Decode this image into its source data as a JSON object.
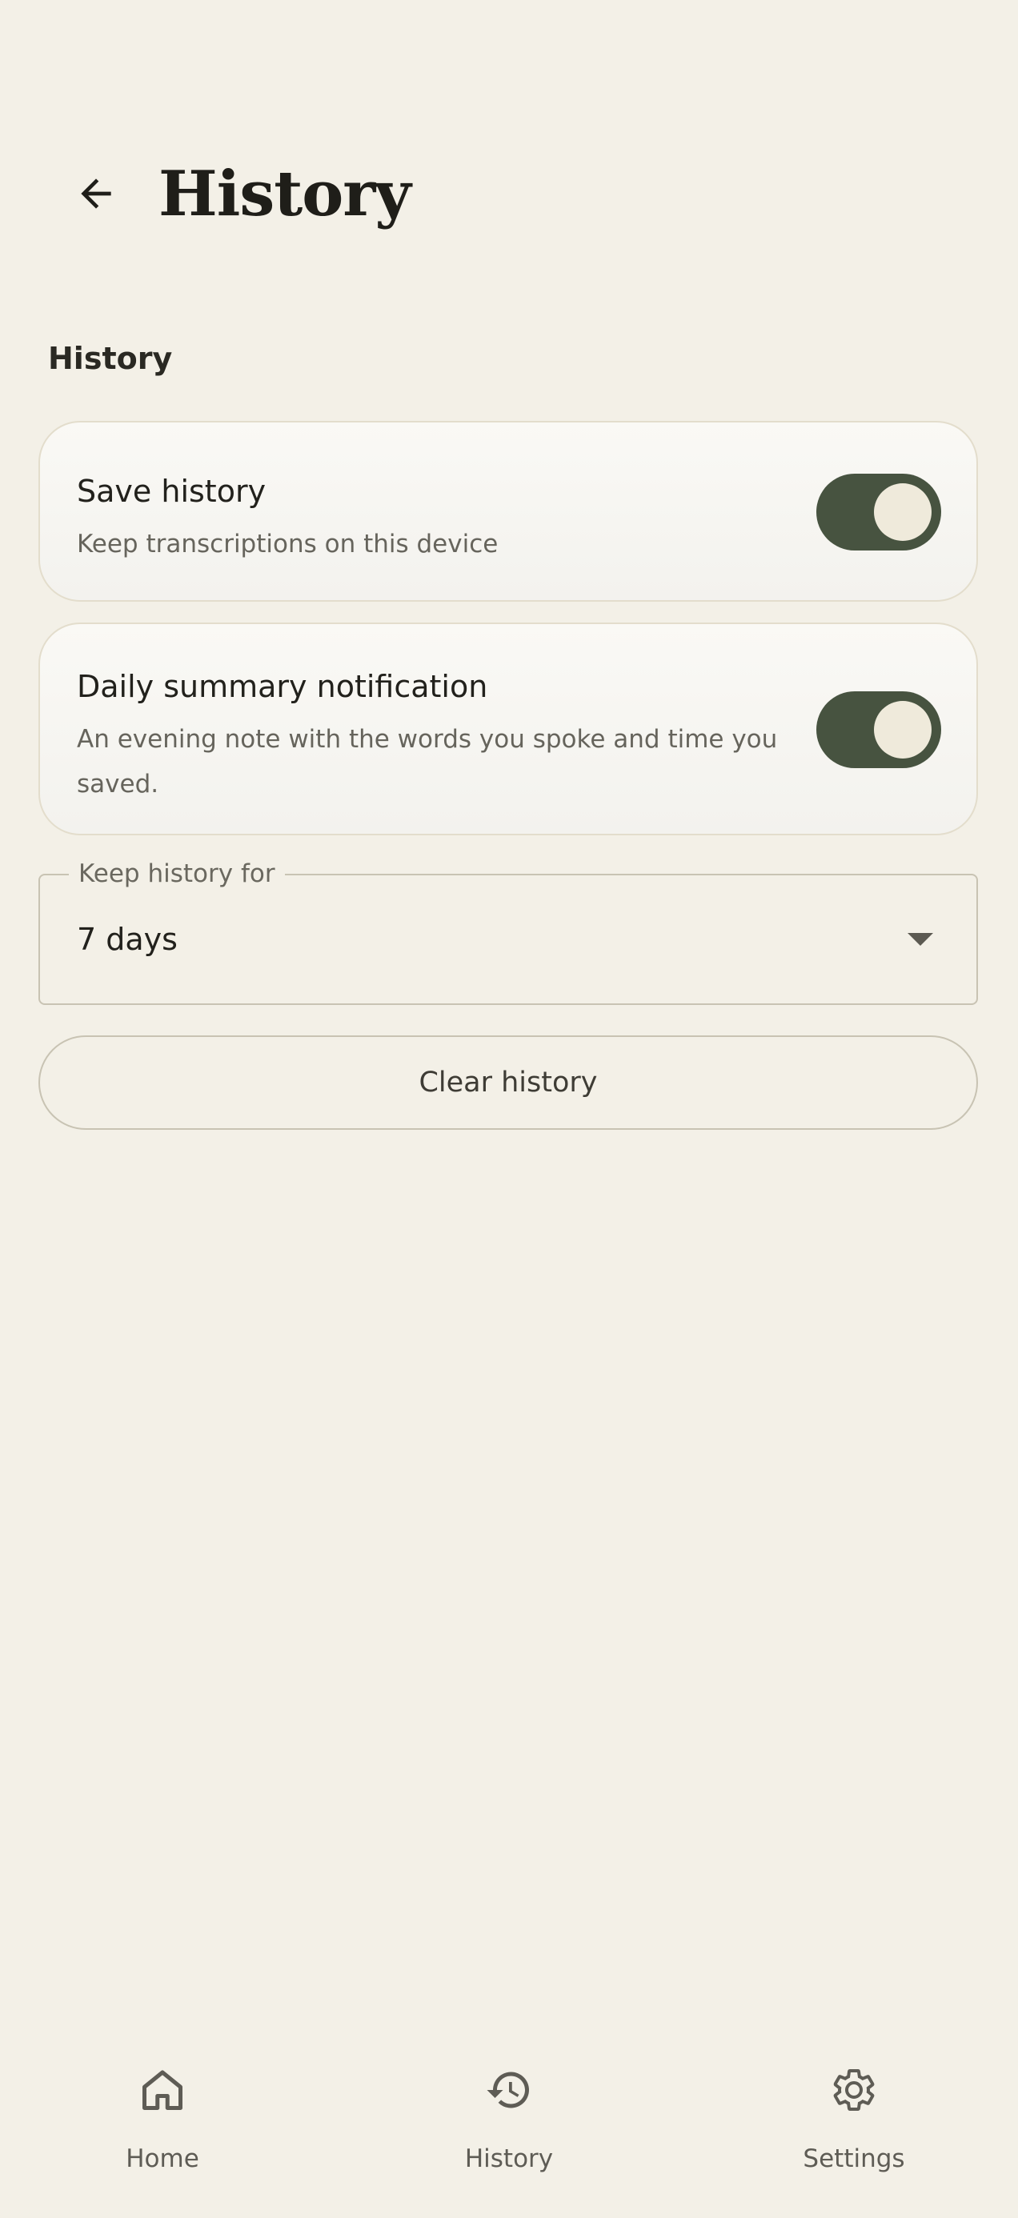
{
  "app_bar": {
    "title": "History"
  },
  "section": {
    "title": "History"
  },
  "settings": [
    {
      "title": "Save history",
      "description": "Keep transcriptions on this device",
      "enabled": true
    },
    {
      "title": "Daily summary notification",
      "description": "An evening note with the words you spoke and time you saved.",
      "enabled": true
    }
  ],
  "retention": {
    "label": "Keep history for",
    "value": "7 days"
  },
  "clear_button": {
    "label": "Clear history"
  },
  "bottom_nav": {
    "items": [
      {
        "label": "Home",
        "icon": "home-icon"
      },
      {
        "label": "History",
        "icon": "history-icon"
      },
      {
        "label": "Settings",
        "icon": "gear-icon"
      }
    ]
  },
  "colors": {
    "background": "#f3f0e7",
    "toggle_on": "#475340",
    "toggle_knob": "#efeadb"
  }
}
